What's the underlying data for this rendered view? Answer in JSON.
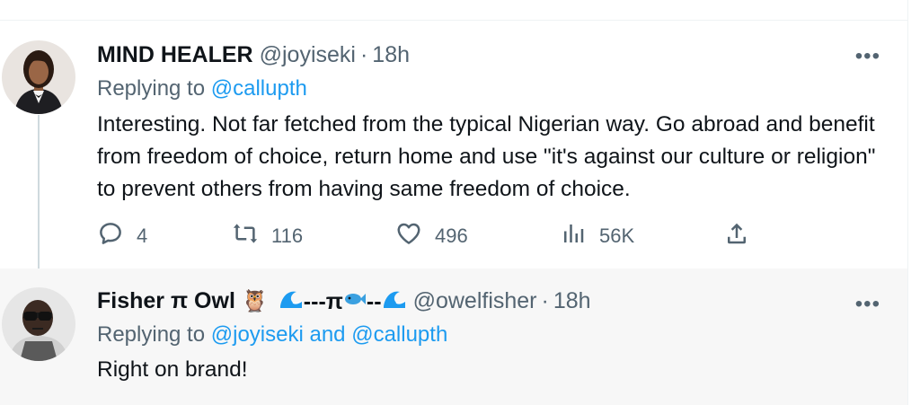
{
  "tweets": [
    {
      "name": "MIND HEALER",
      "handle": "@joyiseki",
      "separator": "·",
      "time": "18h",
      "replying_prefix": "Replying to",
      "replying_to": "@callupth",
      "text": "Interesting. Not far fetched from the typical Nigerian way. Go abroad and benefit from freedom of choice, return home and use \"it's against our culture or religion\" to prevent others from having same freedom of choice.",
      "actions": {
        "reply_count": "4",
        "retweet_count": "116",
        "like_count": "496",
        "views_count": "56K"
      },
      "more": "•••"
    },
    {
      "name": "Fisher π Owl",
      "name_emoji": "🦉",
      "name_suffix": "---π",
      "name_suffix_2": "--",
      "handle": "@owelfisher",
      "separator": "·",
      "time": "18h",
      "replying_prefix": "Replying to",
      "replying_to_1": "@joyiseki",
      "replying_and": "and",
      "replying_to_2": "@callupth",
      "text": "Right on brand!",
      "more": "•••"
    }
  ],
  "icons": [
    "reply-icon",
    "retweet-icon",
    "like-icon",
    "views-icon",
    "share-icon",
    "wave-icon",
    "fish-icon",
    "owl-icon"
  ],
  "colors": {
    "link": "#1d9bf0",
    "muted": "#536471",
    "text": "#0f1419",
    "highlight_bg": "#f7f7f7"
  }
}
